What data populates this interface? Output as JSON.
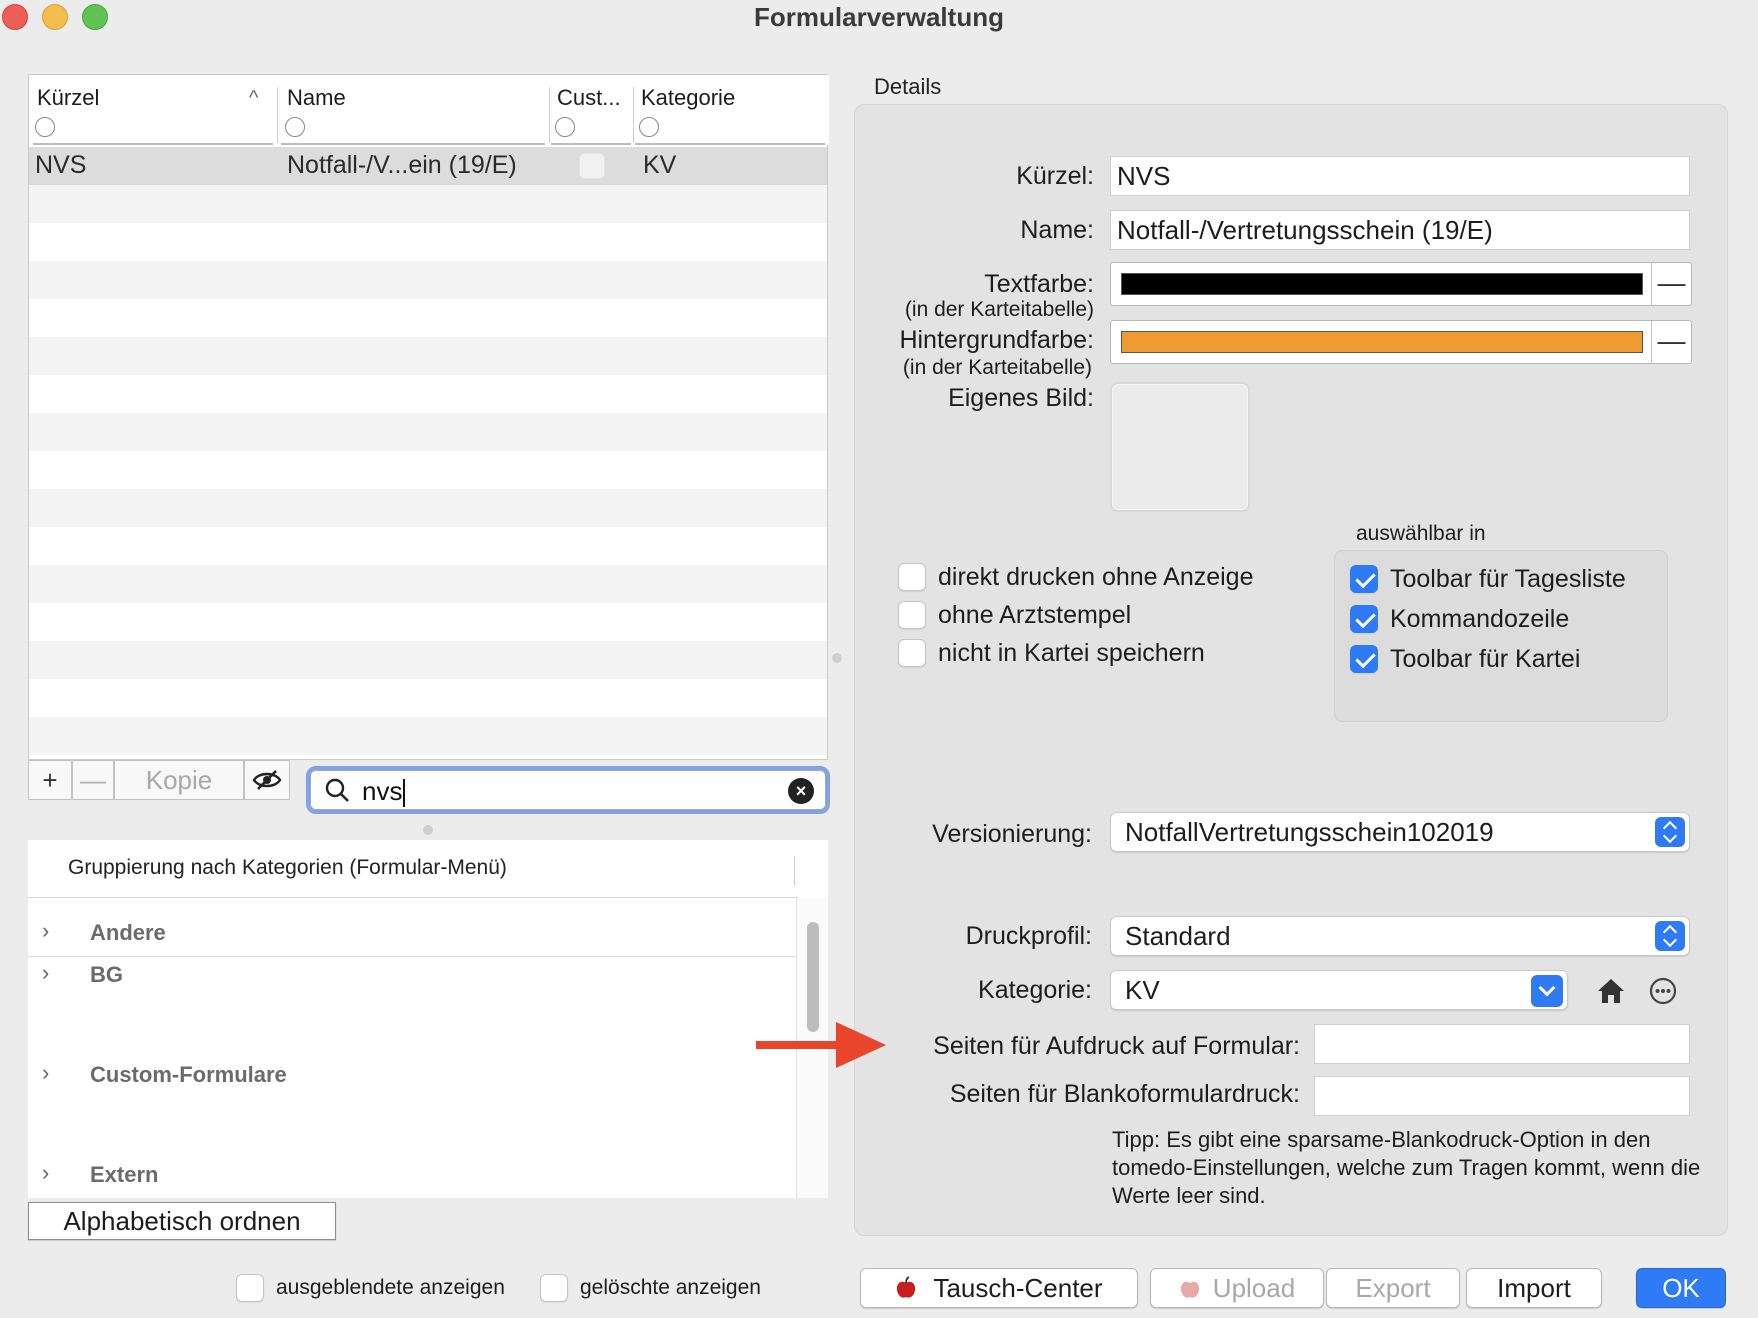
{
  "window": {
    "title": "Formularverwaltung"
  },
  "table": {
    "columns": [
      "Kürzel",
      "Name",
      "Cust...",
      "Kategorie"
    ],
    "rows": [
      {
        "kuerzel": "NVS",
        "name": "Notfall-/V...ein (19/E)",
        "custom": false,
        "kategorie": "KV"
      }
    ]
  },
  "table_toolbar": {
    "add_label": "+",
    "remove_label": "—",
    "copy_label": "Kopie",
    "search_value": "nvs",
    "search_icon": "magnifier-icon",
    "clear_icon": "xmark-circle-icon",
    "visibility_icon": "eye-slash-icon"
  },
  "grouping": {
    "header": "Gruppierung nach Kategorien (Formular-Menü)",
    "items": [
      "Andere",
      "BG",
      "Custom-Formulare",
      "Extern"
    ],
    "sort_button": "Alphabetisch ordnen"
  },
  "footer": {
    "show_hidden_label": "ausgeblendete anzeigen",
    "show_deleted_label": "gelöschte anzeigen",
    "tausch_label": "Tausch-Center",
    "upload_label": "Upload",
    "export_label": "Export",
    "import_label": "Import",
    "ok_label": "OK"
  },
  "details": {
    "title": "Details",
    "kuerzel_label": "Kürzel:",
    "kuerzel_value": "NVS",
    "name_label": "Name:",
    "name_value": "Notfall-/Vertretungsschein (19/E)",
    "textfarbe_label": "Textfarbe:",
    "textfarbe_sub": "(in der Karteitabelle)",
    "textfarbe_color": "#000000",
    "hintergrund_label": "Hintergrundfarbe:",
    "hintergrund_sub": "(in der Karteitabelle)",
    "hintergrund_color": "#f09a34",
    "color_reset_label": "—",
    "bild_label": "Eigenes Bild:",
    "options": [
      {
        "label": "direkt drucken ohne Anzeige",
        "checked": false
      },
      {
        "label": "ohne Arztstempel",
        "checked": false
      },
      {
        "label": "nicht in Kartei speichern",
        "checked": false
      }
    ],
    "auswaehlbar_label": "auswählbar in",
    "auswaehlbar": [
      {
        "label": "Toolbar für Tagesliste",
        "checked": true
      },
      {
        "label": "Kommandozeile",
        "checked": true
      },
      {
        "label": "Toolbar für Kartei",
        "checked": true
      }
    ],
    "versionierung_label": "Versionierung:",
    "versionierung_value": "NotfallVertretungsschein102019",
    "druckprofil_label": "Druckprofil:",
    "druckprofil_value": "Standard",
    "kategorie_label": "Kategorie:",
    "kategorie_value": "KV",
    "home_icon": "house-icon",
    "more_icon": "ellipsis-circle-icon",
    "aufdruck_label": "Seiten für Aufdruck auf Formular:",
    "aufdruck_value": "",
    "blanko_label": "Seiten für Blankoformulardruck:",
    "blanko_value": "",
    "tip": "Tipp: Es gibt eine sparsame-Blankodruck-Option in den tomedo-Einstellungen, welche zum Tragen kommt, wenn die Werte leer sind."
  },
  "colors": {
    "accent": "#2f7bf5",
    "arrow": "#e8452c"
  }
}
